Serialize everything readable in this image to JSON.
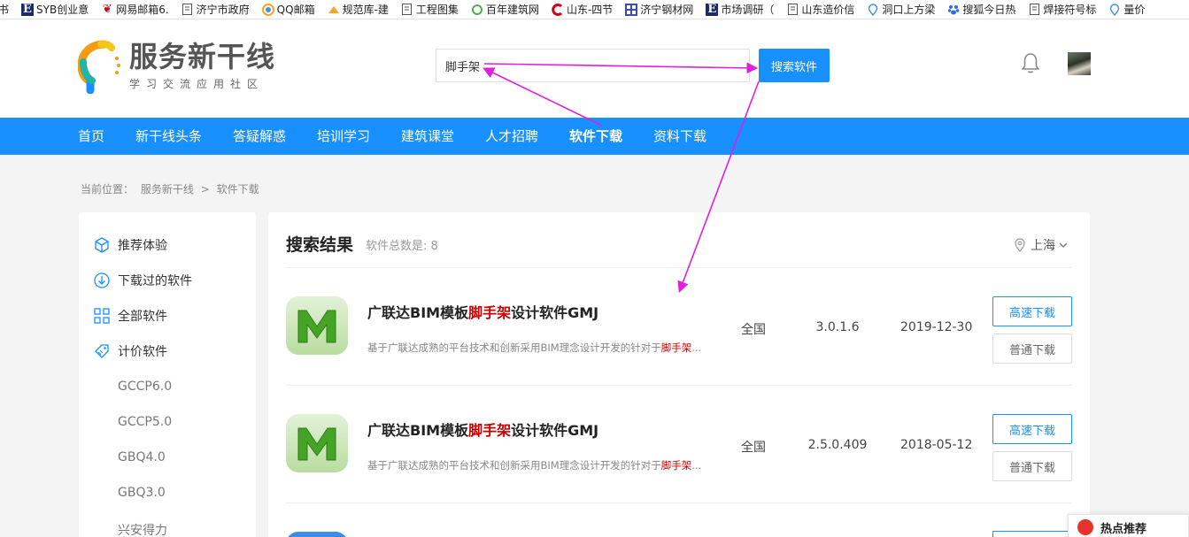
{
  "bookmarks": [
    {
      "label": "书",
      "icon": "none"
    },
    {
      "label": "SYB创业意",
      "icon": "e-letter-icon"
    },
    {
      "label": "网易邮箱6.",
      "icon": "netease-mail-icon"
    },
    {
      "label": "济宁市政府",
      "icon": "page-icon"
    },
    {
      "label": "QQ邮箱",
      "icon": "qq-mail-icon"
    },
    {
      "label": "规范库-建",
      "icon": "standards-icon"
    },
    {
      "label": "工程图集",
      "icon": "page-icon"
    },
    {
      "label": "百年建筑网",
      "icon": "green-swirl-icon"
    },
    {
      "label": "山东-四节",
      "icon": "red-c-icon"
    },
    {
      "label": "济宁钢材网",
      "icon": "grid-icon"
    },
    {
      "label": "市场调研（",
      "icon": "e-letter-icon"
    },
    {
      "label": "山东造价信",
      "icon": "page-icon"
    },
    {
      "label": "洞口上方梁",
      "icon": "pin-icon"
    },
    {
      "label": "搜狐今日热",
      "icon": "paw-icon"
    },
    {
      "label": "焊接符号标",
      "icon": "page-icon"
    },
    {
      "label": "量价",
      "icon": "pin-icon"
    }
  ],
  "logo": {
    "title": "服务新干线",
    "subtitle": "学习交流应用社区"
  },
  "search": {
    "value": "脚手架",
    "button_label": "搜索软件"
  },
  "nav": {
    "items": [
      {
        "label": "首页",
        "active": false
      },
      {
        "label": "新干线头条",
        "active": false
      },
      {
        "label": "答疑解惑",
        "active": false
      },
      {
        "label": "培训学习",
        "active": false
      },
      {
        "label": "建筑课堂",
        "active": false
      },
      {
        "label": "人才招聘",
        "active": false
      },
      {
        "label": "软件下载",
        "active": true
      },
      {
        "label": "资料下载",
        "active": false
      }
    ]
  },
  "breadcrumb": {
    "prefix": "当前位置：",
    "home": "服务新干线",
    "separator": ">",
    "current": "软件下载"
  },
  "sidebar": {
    "items": [
      {
        "label": "推荐体验",
        "icon": "cube-icon"
      },
      {
        "label": "下载过的软件",
        "icon": "download-circle-icon"
      },
      {
        "label": "全部软件",
        "icon": "grid-icon"
      },
      {
        "label": "计价软件",
        "icon": "price-tag-icon"
      }
    ],
    "sub_items": [
      "GCCP6.0",
      "GCCP5.0",
      "GBQ4.0",
      "GBQ3.0",
      "兴安得力"
    ]
  },
  "results": {
    "title": "搜索结果",
    "count_label": "软件总数是: 8",
    "location": "上海",
    "items": [
      {
        "title_before": "广联达BIM模板",
        "title_highlight": "脚手架",
        "title_after": "设计软件GMJ",
        "desc_before": "基于广联达成熟的平台技术和创新采用BIM理念设计开发的针对于",
        "desc_highlight": "脚手架",
        "desc_after": "...",
        "region": "全国",
        "version": "3.0.1.6",
        "date": "2019-12-30",
        "fast_label": "高速下载",
        "normal_label": "普通下载"
      },
      {
        "title_before": "广联达BIM模板",
        "title_highlight": "脚手架",
        "title_after": "设计软件GMJ",
        "desc_before": "基于广联达成熟的平台技术和创新采用BIM理念设计开发的针对于",
        "desc_highlight": "脚手架",
        "desc_after": "...",
        "region": "全国",
        "version": "2.5.0.409",
        "date": "2018-05-12",
        "fast_label": "高速下载",
        "normal_label": "普通下载"
      }
    ]
  },
  "hot_panel": {
    "label": "热点推荐"
  },
  "colors": {
    "primary": "#1890ff",
    "highlight": "#cc0000",
    "annotation": "#e020e0"
  }
}
